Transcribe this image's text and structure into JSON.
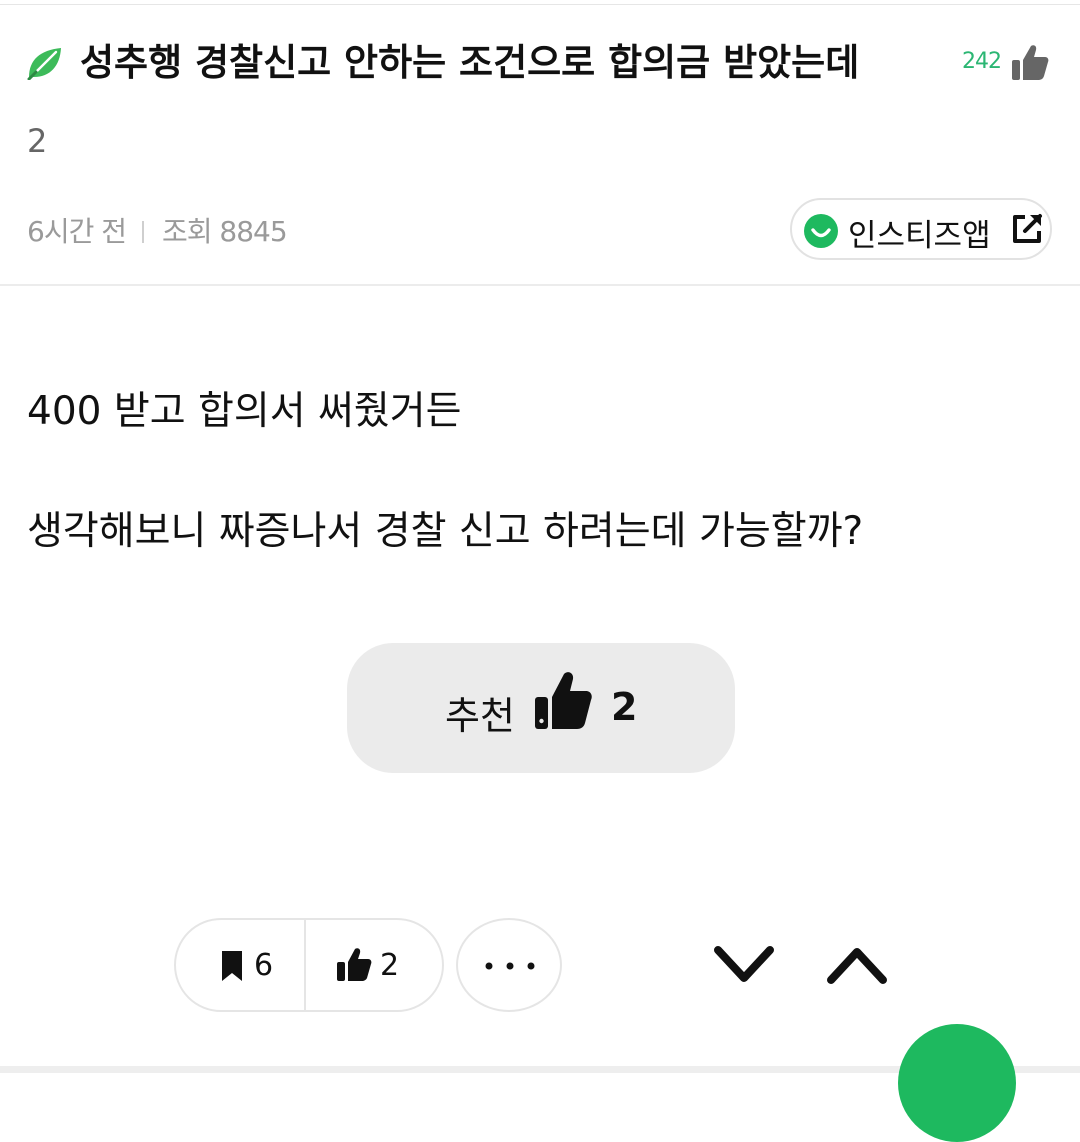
{
  "post": {
    "title": "성추행 경찰신고 안하는 조건으로 합의금 받았는데",
    "like_count": "242",
    "comment_count": "2",
    "time_ago": "6시간 전",
    "views_label": "조회 8845"
  },
  "app_button": {
    "label": "인스티즈앱"
  },
  "content": {
    "lines": [
      "400 받고 합의서 써줬거든",
      "생각해보니 짜증나서 경찰 신고 하려는데 가능할까?"
    ]
  },
  "recommend": {
    "label": "추천",
    "count": "2"
  },
  "toolbar": {
    "bookmark_count": "6",
    "like_count": "2"
  },
  "colors": {
    "accent": "#1eb95f",
    "like_green": "#2bb673",
    "button_bg": "#ebebeb"
  },
  "icons": [
    "leaf-icon",
    "thumbs-up-icon",
    "smile-icon",
    "external-link-icon",
    "bookmark-icon",
    "more-icon",
    "chevron-down-icon",
    "chevron-up-icon"
  ]
}
